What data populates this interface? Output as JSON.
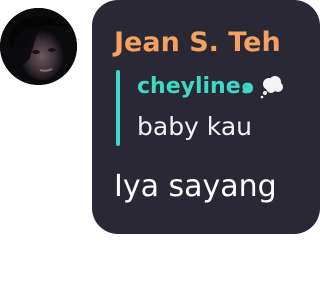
{
  "message": {
    "sender_name": "Jean S. Teh",
    "reply": {
      "author": "cheyline๑",
      "author_emoji": "thought-balloon-icon",
      "text": "baby kau"
    },
    "text": "Iya sayang"
  },
  "colors": {
    "bubble_background": "#2a2834",
    "sender_name": "#f5a15f",
    "reply_accent": "#3fd8c4",
    "message_text": "#ffffff"
  }
}
